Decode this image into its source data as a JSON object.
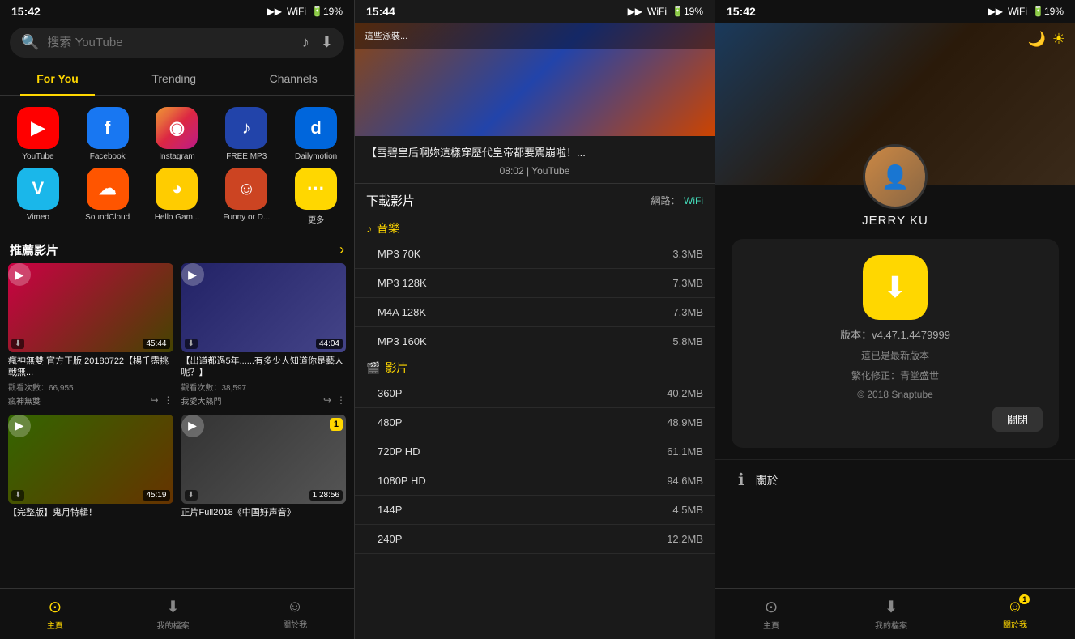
{
  "panels": {
    "left": {
      "status_time": "15:42",
      "status_icons": "▶ ▶ WiFi 🔋19%",
      "search_placeholder": "搜索 YouTube",
      "tabs": [
        {
          "label": "For You",
          "active": true
        },
        {
          "label": "Trending",
          "active": false
        },
        {
          "label": "Channels",
          "active": false
        }
      ],
      "apps": [
        {
          "label": "YouTube",
          "icon": "▶",
          "color": "#FF0000"
        },
        {
          "label": "Facebook",
          "icon": "f",
          "color": "#1877F2"
        },
        {
          "label": "Instagram",
          "icon": "◉",
          "color": "#C13584"
        },
        {
          "label": "FREE MP3",
          "icon": "♪",
          "color": "#2244aa"
        },
        {
          "label": "Dailymotion",
          "icon": "d",
          "color": "#0066DC"
        },
        {
          "label": "Vimeo",
          "icon": "v",
          "color": "#1AB7EA"
        },
        {
          "label": "SoundCloud",
          "icon": "☁",
          "color": "#FF5500"
        },
        {
          "label": "Hello Gam...",
          "icon": "◕",
          "color": "#FFCC00"
        },
        {
          "label": "Funny or D...",
          "icon": "☺",
          "color": "#cc4422"
        },
        {
          "label": "更多",
          "icon": "•••",
          "color": "#FFD700"
        }
      ],
      "section_title": "推薦影片",
      "videos": [
        {
          "title": "瘋神無雙 官方正版 20180722【楊千霈挑戰無...",
          "views": "觀看次數：66,955",
          "channel": "瘋神無雙",
          "duration": "45:44",
          "thumb_class": "thumb-bg-1"
        },
        {
          "title": "【出道都過5年......有多少人知道你是藝人呢？】",
          "views": "觀看次數：38,597",
          "channel": "我愛大熱門",
          "duration": "44:04",
          "thumb_class": "thumb-bg-2"
        },
        {
          "title": "【完整版】鬼月特輯！",
          "views": "",
          "channel": "",
          "duration": "45:19",
          "thumb_class": "thumb-bg-3"
        },
        {
          "title": "正片Full2018《中国好声音》",
          "views": "",
          "channel": "",
          "duration": "1:28:56",
          "thumb_class": "thumb-bg-4",
          "badge": "1"
        }
      ],
      "nav": [
        {
          "label": "主頁",
          "icon": "⊙",
          "active": true
        },
        {
          "label": "我的檔案",
          "icon": "⬇",
          "active": false
        },
        {
          "label": "關於我",
          "icon": "☺",
          "active": false
        }
      ]
    },
    "mid": {
      "status_time": "15:44",
      "vid_title": "【雪碧皇后啊妳這樣穿歷代皇帝都要駡崩啦！...",
      "vid_source": "08:02 | YouTube",
      "dl_label": "下載影片",
      "network_label": "網路：",
      "network_val": "WiFi",
      "audio_section": "音樂",
      "audio_icon": "♪",
      "video_section": "影片",
      "video_icon": "🎬",
      "formats_audio": [
        {
          "label": "MP3 70K",
          "size": "3.3MB"
        },
        {
          "label": "MP3 128K",
          "size": "7.3MB"
        },
        {
          "label": "M4A 128K",
          "size": "7.3MB"
        },
        {
          "label": "MP3 160K",
          "size": "5.8MB"
        }
      ],
      "formats_video": [
        {
          "label": "360P",
          "size": "40.2MB"
        },
        {
          "label": "480P",
          "size": "48.9MB"
        },
        {
          "label": "720P HD",
          "size": "61.1MB"
        },
        {
          "label": "1080P HD",
          "size": "94.6MB"
        },
        {
          "label": "144P",
          "size": "4.5MB"
        },
        {
          "label": "240P",
          "size": "12.2MB"
        }
      ]
    },
    "right": {
      "status_time": "15:42",
      "profile_name": "JERRY KU",
      "actions": [
        {
          "icon": "↑",
          "label": ""
        },
        {
          "icon": "↪",
          "label": ""
        },
        {
          "icon": "⬇",
          "label": ""
        },
        {
          "icon": "↗",
          "label": ""
        },
        {
          "icon": "☺",
          "label": ""
        },
        {
          "icon": "⚙",
          "label": ""
        }
      ],
      "about": {
        "version_label": "版本：v4.47.1.4479999",
        "latest_label": "這已是最新版本",
        "translator_label": "繁化修正：青堂盛世",
        "copyright_label": "© 2018 Snaptube",
        "close_btn": "關閉"
      },
      "about_action_label": "關於",
      "nav": [
        {
          "label": "主頁",
          "icon": "⊙",
          "active": false
        },
        {
          "label": "我的檔案",
          "icon": "⬇",
          "active": false
        },
        {
          "label": "關於我",
          "icon": "☺",
          "active": true
        }
      ],
      "nav_badge": "1"
    }
  }
}
